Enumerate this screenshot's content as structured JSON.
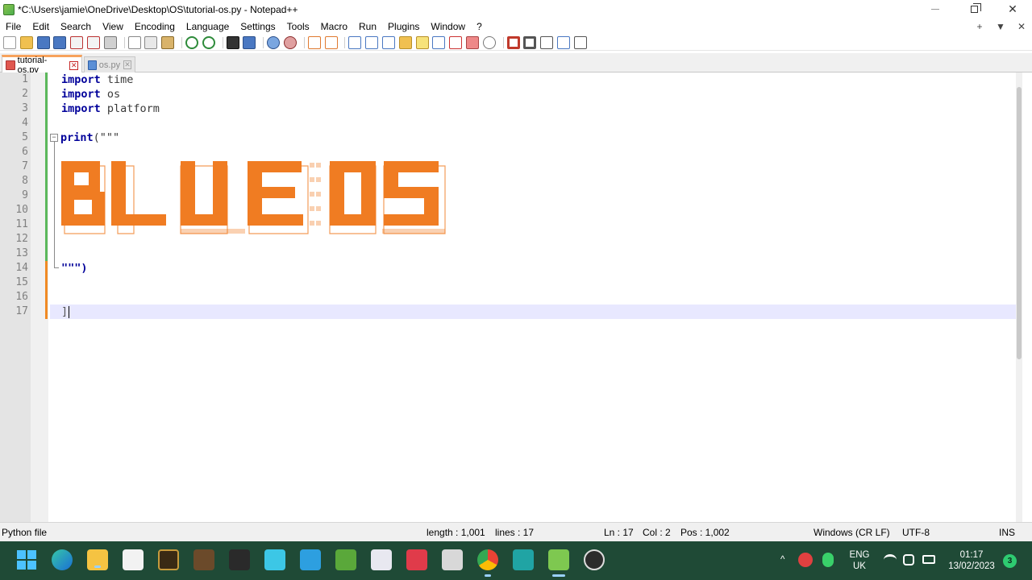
{
  "window": {
    "title": "*C:\\Users\\jamie\\OneDrive\\Desktop\\OS\\tutorial-os.py - Notepad++",
    "minimize_icon": "minimize-icon",
    "restore_icon": "restore-icon",
    "close_glyph": "✕"
  },
  "menu": {
    "items": [
      "File",
      "Edit",
      "Search",
      "View",
      "Encoding",
      "Language",
      "Settings",
      "Tools",
      "Macro",
      "Run",
      "Plugins",
      "Window",
      "?"
    ],
    "right": [
      "+",
      "▼",
      "✕"
    ]
  },
  "tabs": [
    {
      "label": "tutorial-os.py",
      "active": true
    },
    {
      "label": "os.py",
      "active": false
    }
  ],
  "editor": {
    "line_numbers": [
      "1",
      "2",
      "3",
      "4",
      "5",
      "6",
      "7",
      "8",
      "9",
      "10",
      "11",
      "12",
      "13",
      "14",
      "15",
      "16",
      "17"
    ],
    "lines": [
      {
        "keyword": "import",
        "rest": " time"
      },
      {
        "keyword": "import",
        "rest": " os"
      },
      {
        "keyword": "import",
        "rest": " platform"
      },
      {
        "keyword": "",
        "rest": ""
      },
      {
        "keyword": "print",
        "rest": "(\"\"\""
      },
      {
        "keyword": "",
        "rest": ""
      },
      {
        "keyword": "",
        "rest": ""
      },
      {
        "keyword": "",
        "rest": ""
      },
      {
        "keyword": "",
        "rest": ""
      },
      {
        "keyword": "",
        "rest": ""
      },
      {
        "keyword": "",
        "rest": ""
      },
      {
        "keyword": "",
        "rest": ""
      },
      {
        "keyword": "",
        "rest": ""
      },
      {
        "keyword": "",
        "rest": "\"\"\")"
      },
      {
        "keyword": "",
        "rest": ""
      },
      {
        "keyword": "",
        "rest": ""
      },
      {
        "keyword": "",
        "rest": "]"
      }
    ],
    "ascii_banner_text": "BLUE OS",
    "banner_color": "#f07c22",
    "current_line": 17
  },
  "status": {
    "file_type": "Python file",
    "length": "length : 1,001",
    "lines": "lines : 17",
    "ln": "Ln : 17",
    "col": "Col : 2",
    "pos": "Pos : 1,002",
    "eol": "Windows (CR LF)",
    "encoding": "UTF-8",
    "mode": "INS"
  },
  "taskbar": {
    "lang_top": "ENG",
    "lang_bottom": "UK",
    "time": "01:17",
    "date": "13/02/2023",
    "notifications": "3"
  },
  "colors": {
    "taskbar_bg": "#1f4a36",
    "keyword": "#00009a",
    "current_line_bg": "#e8e8ff",
    "active_tab_accent": "#f7a25c"
  }
}
